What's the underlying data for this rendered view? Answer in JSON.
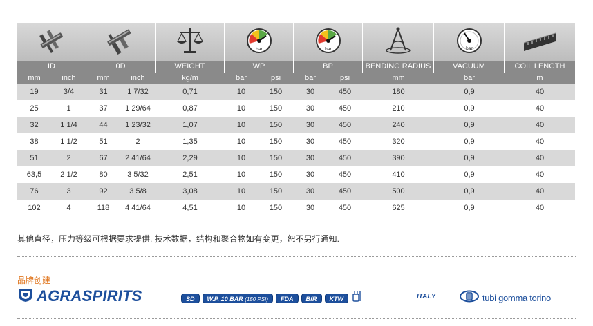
{
  "columns": [
    {
      "key": "id",
      "header": "ID",
      "icon": "caliper-icon",
      "units": [
        "mm",
        "inch"
      ]
    },
    {
      "key": "od",
      "header": "0D",
      "icon": "outer-caliper-icon",
      "units": [
        "mm",
        "inch"
      ]
    },
    {
      "key": "weight",
      "header": "WEIGHT",
      "icon": "scale-icon",
      "units": [
        "kg/m"
      ]
    },
    {
      "key": "wp",
      "header": "WP",
      "icon": "pressure-gauge-icon",
      "units": [
        "bar",
        "psi"
      ]
    },
    {
      "key": "bp",
      "header": "BP",
      "icon": "pressure-gauge-icon",
      "units": [
        "bar",
        "psi"
      ]
    },
    {
      "key": "bending",
      "header": "BENDING RADIUS",
      "icon": "compass-icon",
      "units": [
        "mm"
      ]
    },
    {
      "key": "vacuum",
      "header": "VACUUM",
      "icon": "vacuum-gauge-icon",
      "units": [
        "bar"
      ]
    },
    {
      "key": "coil",
      "header": "COIL LENGTH",
      "icon": "tape-measure-icon",
      "units": [
        "m"
      ]
    }
  ],
  "rows": [
    [
      "19",
      "3/4",
      "31",
      "1 7/32",
      "0,71",
      "10",
      "150",
      "30",
      "450",
      "180",
      "0,9",
      "40"
    ],
    [
      "25",
      "1",
      "37",
      "1 29/64",
      "0,87",
      "10",
      "150",
      "30",
      "450",
      "210",
      "0,9",
      "40"
    ],
    [
      "32",
      "1 1/4",
      "44",
      "1 23/32",
      "1,07",
      "10",
      "150",
      "30",
      "450",
      "240",
      "0,9",
      "40"
    ],
    [
      "38",
      "1 1/2",
      "51",
      "2",
      "1,35",
      "10",
      "150",
      "30",
      "450",
      "320",
      "0,9",
      "40"
    ],
    [
      "51",
      "2",
      "67",
      "2 41/64",
      "2,29",
      "10",
      "150",
      "30",
      "450",
      "390",
      "0,9",
      "40"
    ],
    [
      "63,5",
      "2 1/2",
      "80",
      "3 5/32",
      "2,51",
      "10",
      "150",
      "30",
      "450",
      "410",
      "0,9",
      "40"
    ],
    [
      "76",
      "3",
      "92",
      "3 5/8",
      "3,08",
      "10",
      "150",
      "30",
      "450",
      "500",
      "0,9",
      "40"
    ],
    [
      "102",
      "4",
      "118",
      "4 41/64",
      "4,51",
      "10",
      "150",
      "30",
      "450",
      "625",
      "0,9",
      "40"
    ]
  ],
  "note": "其他直径，压力等级可根据要求提供. 技术数据，结构和聚合物如有变更，恕不另行通知.",
  "brand": {
    "title": "品牌创建",
    "name": "AGRASPIRITS",
    "badges": [
      {
        "text": "SD"
      },
      {
        "text": "W.P. 10 BAR",
        "small": "(150 PSI)"
      },
      {
        "text": "FDA"
      },
      {
        "text": "BfR"
      },
      {
        "text": "KTW"
      }
    ],
    "origin": "ITALY",
    "maker": "tubi gomma torino"
  },
  "colors": {
    "header_bg": "#8a8a8a",
    "icon_bg": "#cacaca",
    "stripe": "#d9d9d9",
    "brand_blue": "#1d4f9c",
    "brand_title": "#e0761f"
  }
}
